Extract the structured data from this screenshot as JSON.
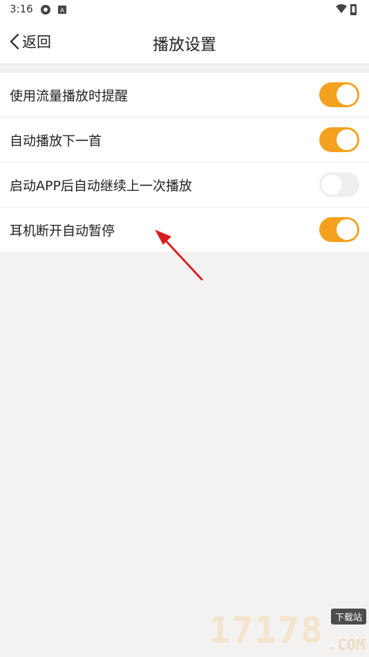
{
  "status_bar": {
    "time": "3:16",
    "icons_left": [
      "settings-gear-icon",
      "a-badge-icon"
    ],
    "icons_right": [
      "wifi-icon",
      "battery-icon"
    ]
  },
  "header": {
    "back_label": "返回",
    "title": "播放设置"
  },
  "settings": [
    {
      "label": "使用流量播放时提醒",
      "enabled": true
    },
    {
      "label": "自动播放下一首",
      "enabled": true
    },
    {
      "label": "启动APP后自动继续上一次播放",
      "enabled": false
    },
    {
      "label": "耳机断开自动暂停",
      "enabled": true
    }
  ],
  "colors": {
    "accent": "#f3a11f",
    "annotation_arrow": "#d81f1f",
    "background": "#f3f2f1"
  },
  "watermark": {
    "number": "17178",
    "badge": "下载站",
    "domain": ".COM"
  }
}
